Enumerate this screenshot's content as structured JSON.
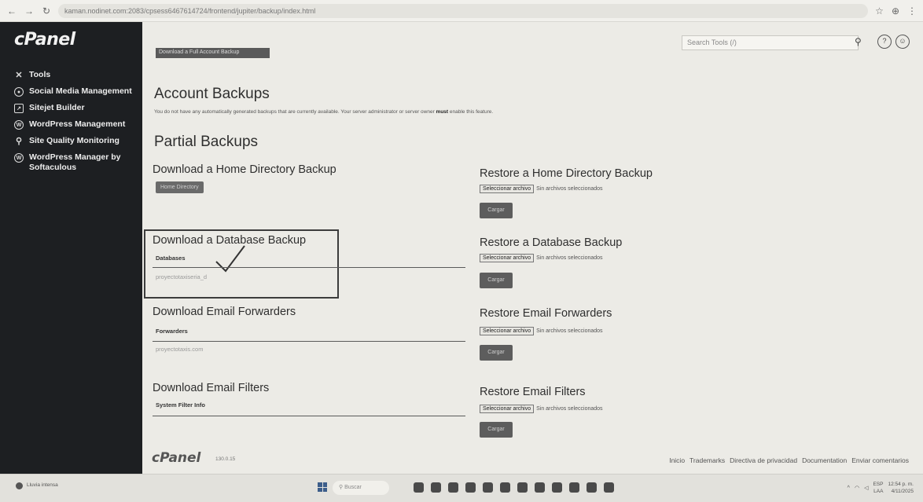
{
  "browser": {
    "url": "kaman.nodinet.com:2083/cpsess6467614724/frontend/jupiter/backup/index.html"
  },
  "sidebar": {
    "logo": "cPanel",
    "items": [
      {
        "label": "Tools",
        "icon": "tools-icon"
      },
      {
        "label": "Social Media Management",
        "icon": "social-icon"
      },
      {
        "label": "Sitejet Builder",
        "icon": "sitejet-icon"
      },
      {
        "label": "WordPress Management",
        "icon": "wordpress-icon"
      },
      {
        "label": "Site Quality Monitoring",
        "icon": "site-quality-icon"
      },
      {
        "label": "WordPress Manager by Softaculous",
        "icon": "wordpress-icon"
      }
    ]
  },
  "header": {
    "search_placeholder": "Search Tools (/)",
    "prev_button": "Download a Full Account Backup"
  },
  "main": {
    "account_title": "Account Backups",
    "account_notice_pre": "You do not have any automatically generated backups that are currently available. Your server administrator or server owner ",
    "account_notice_bold": "must",
    "account_notice_post": " enable this feature.",
    "partial_title": "Partial Backups",
    "home_download_title": "Download a Home Directory Backup",
    "home_button": "Home Directory",
    "home_restore_title": "Restore a Home Directory Backup",
    "db_download_title": "Download a Database Backup",
    "db_column": "Databases",
    "db_row": "proyectotaxiseria_d",
    "db_restore_title": "Restore a Database Backup",
    "fwd_download_title": "Download Email Forwarders",
    "fwd_column": "Forwarders",
    "fwd_row": "proyectotaxis.com",
    "fwd_restore_title": "Restore Email Forwarders",
    "filter_download_title": "Download Email Filters",
    "filter_column": "System Filter Info",
    "filter_restore_title": "Restore Email Filters",
    "file_button": "Seleccionar archivo",
    "file_status": "Sin archivos seleccionados",
    "upload_button": "Cargar"
  },
  "footer": {
    "logo": "cPanel",
    "version": "130.0.15",
    "links": [
      "Inicio",
      "Trademarks",
      "Directiva de privacidad",
      "Documentation",
      "Enviar comentarios"
    ]
  },
  "taskbar": {
    "weather": "Lluvia intensa",
    "search": "Buscar",
    "lang": "ESP",
    "lang2": "LAA",
    "time": "12:54 p. m.",
    "date": "4/11/2025"
  }
}
